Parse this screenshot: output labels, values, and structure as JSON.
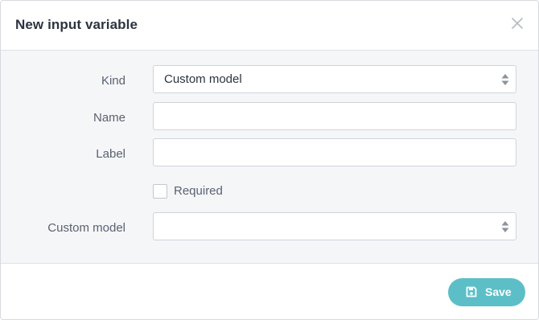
{
  "dialog": {
    "title": "New input variable"
  },
  "form": {
    "kind": {
      "label": "Kind",
      "value": "Custom model"
    },
    "name": {
      "label": "Name",
      "value": ""
    },
    "label": {
      "label": "Label",
      "value": ""
    },
    "required": {
      "label": "Required",
      "checked": false
    },
    "custom_model": {
      "label": "Custom model",
      "value": ""
    }
  },
  "footer": {
    "save_label": "Save"
  },
  "colors": {
    "accent": "#5cbfc7",
    "body_background": "#f5f6f8",
    "border": "#cfd4da"
  }
}
